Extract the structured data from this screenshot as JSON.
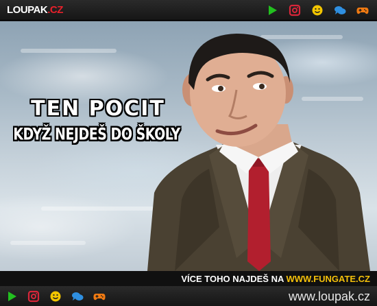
{
  "header": {
    "logo_part1": "LOUPAK",
    "logo_part2": ".CZ",
    "icons": [
      "play-icon",
      "instagram-icon",
      "smiley-icon",
      "chat-icon",
      "gamepad-icon"
    ]
  },
  "meme": {
    "caption_line1": "TEN POCIT",
    "caption_line2": "KDYŽ NEJDEŠ DO ŠKOLY"
  },
  "footer": {
    "promo_text": "VÍCE TOHO NAJDEŠ NA ",
    "promo_site": "WWW.FUNGATE.CZ",
    "website": "www.loupak.cz"
  },
  "colors": {
    "play": "#22c01f",
    "instagram": "#d9263a",
    "smiley": "#f2c500",
    "chat": "#2f8fe0",
    "gamepad": "#f07a12",
    "accent_red": "#e8202a",
    "promo_yellow": "#f5c10a"
  }
}
